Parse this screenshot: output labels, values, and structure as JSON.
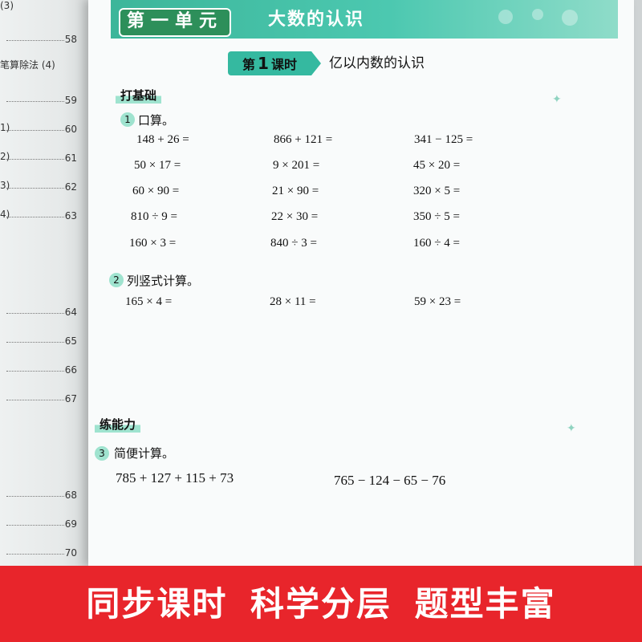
{
  "toc": [
    {
      "text": "(3)",
      "num": ""
    },
    {
      "text": "",
      "num": "58"
    },
    {
      "text": "笔算除法 (4)",
      "num": ""
    },
    {
      "text": "",
      "num": "59"
    },
    {
      "text": "1)",
      "num": "60"
    },
    {
      "text": "2)",
      "num": "61"
    },
    {
      "text": "3)",
      "num": "62"
    },
    {
      "text": "4)",
      "num": "63"
    },
    {
      "text": "",
      "num": "64"
    },
    {
      "text": "",
      "num": "65"
    },
    {
      "text": "",
      "num": "66"
    },
    {
      "text": "",
      "num": "67"
    },
    {
      "text": "",
      "num": "68"
    },
    {
      "text": "",
      "num": "69"
    },
    {
      "text": "",
      "num": "70"
    }
  ],
  "unit": {
    "label": "第一单元",
    "title": "大数的认识"
  },
  "lesson": {
    "tag_prefix": "第",
    "tag_number": "1",
    "tag_suffix": "课时",
    "title": "亿以内数的认识"
  },
  "section1": {
    "title": "打基础",
    "q1": {
      "num": "1",
      "text": "口算。"
    },
    "oral": [
      [
        "148 + 26 =",
        "866 + 121 =",
        "341 − 125 ="
      ],
      [
        "50 × 17 =",
        "9 × 201 =",
        "45 × 20 ="
      ],
      [
        "60 × 90 =",
        "21 × 90 =",
        "320 × 5 ="
      ],
      [
        "810 ÷ 9 =",
        "22 × 30 =",
        "350 ÷ 5 ="
      ],
      [
        "160 × 3 =",
        "840 ÷ 3 =",
        "160 ÷ 4 ="
      ]
    ],
    "q2": {
      "num": "2",
      "text": "列竖式计算。"
    },
    "vertical": [
      "165 × 4 =",
      "28 × 11 =",
      "59 × 23 ="
    ]
  },
  "section2": {
    "title": "练能力",
    "q3": {
      "num": "3",
      "text": "简便计算。"
    },
    "simplify": [
      "785 + 127 + 115 + 73",
      "765 − 124 − 65 − 76"
    ]
  },
  "bottom_banner": {
    "phrases": [
      "同步课时",
      "科学分层",
      "题型丰富"
    ]
  },
  "colors": {
    "teal": "#35b9a0",
    "mint": "#9fe3cf",
    "banner_red": "#e8252b",
    "unit_green": "#2d8f5a"
  }
}
